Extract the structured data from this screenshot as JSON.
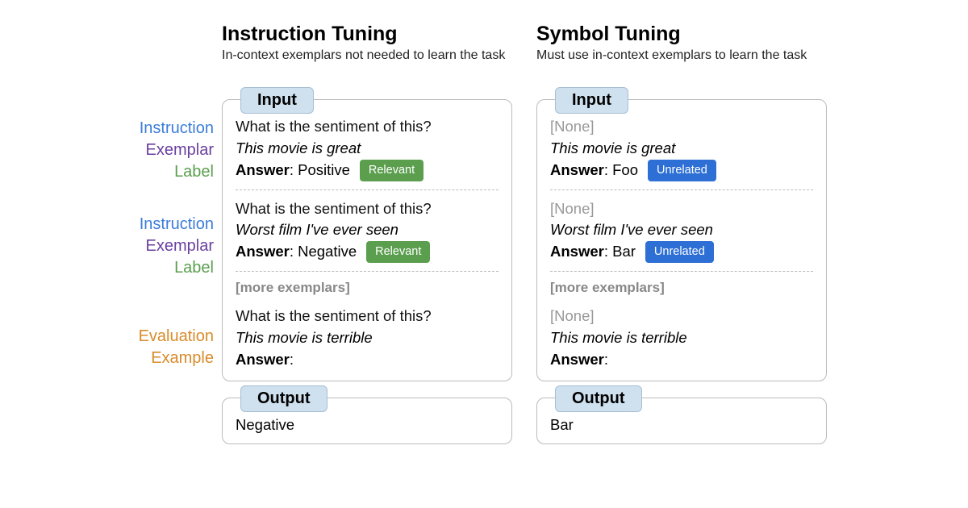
{
  "labels": {
    "instruction": "Instruction",
    "exemplar": "Exemplar",
    "label": "Label",
    "evaluation": "Evaluation",
    "example": "Example"
  },
  "shared": {
    "input_tab": "Input",
    "output_tab": "Output",
    "more": "[more exemplars]",
    "answer_prefix": "Answer",
    "none": "[None]"
  },
  "left": {
    "title": "Instruction Tuning",
    "subtitle": "In-context exemplars not needed to learn the task",
    "badge": "Relevant",
    "ex1": {
      "instr": "What is the sentiment of this?",
      "text": "This movie is great",
      "answer": ": Positive"
    },
    "ex2": {
      "instr": "What is the sentiment of this?",
      "text": "Worst film I've ever seen",
      "answer": ": Negative"
    },
    "eval": {
      "instr": "What is the sentiment of this?",
      "text": "This movie is terrible",
      "answer": ":"
    },
    "output": "Negative"
  },
  "right": {
    "title": "Symbol Tuning",
    "subtitle": "Must use in-context exemplars to learn the task",
    "badge": "Unrelated",
    "ex1": {
      "text": "This movie is great",
      "answer": ": Foo"
    },
    "ex2": {
      "text": "Worst film I've ever seen",
      "answer": ": Bar"
    },
    "eval": {
      "text": "This movie is terrible",
      "answer": ":"
    },
    "output": "Bar"
  }
}
